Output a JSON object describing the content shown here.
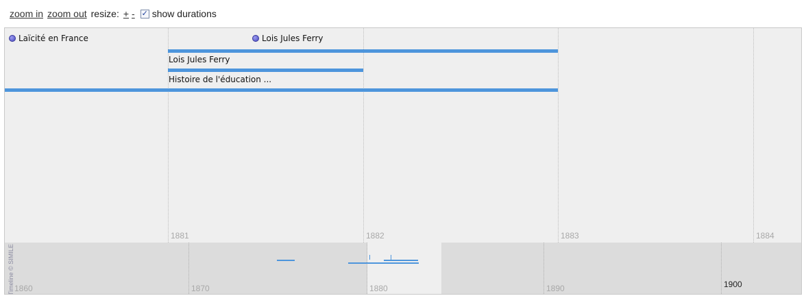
{
  "controls": {
    "zoom_in": "zoom in",
    "zoom_out": "zoom out",
    "resize_label": "resize:",
    "plus": "+",
    "minus": "-",
    "checkbox_checked": "✓",
    "show_durations": "show durations"
  },
  "upper_band": {
    "ticks": [
      "1881",
      "1882",
      "1883",
      "1884"
    ],
    "point_events": [
      "Laïcité en France",
      "Lois Jules Ferry"
    ],
    "duration_events": [
      "Lois Jules Ferry",
      "Histoire de l'éducation ..."
    ]
  },
  "lower_band": {
    "ticks": [
      "1860",
      "1870",
      "1880",
      "1890",
      "1900"
    ]
  },
  "credit": "Timeline © SIMILE",
  "colors": {
    "event_bar": "#4d95dc",
    "upper_bg": "#efefef",
    "lower_bg": "#dcdcdc"
  }
}
